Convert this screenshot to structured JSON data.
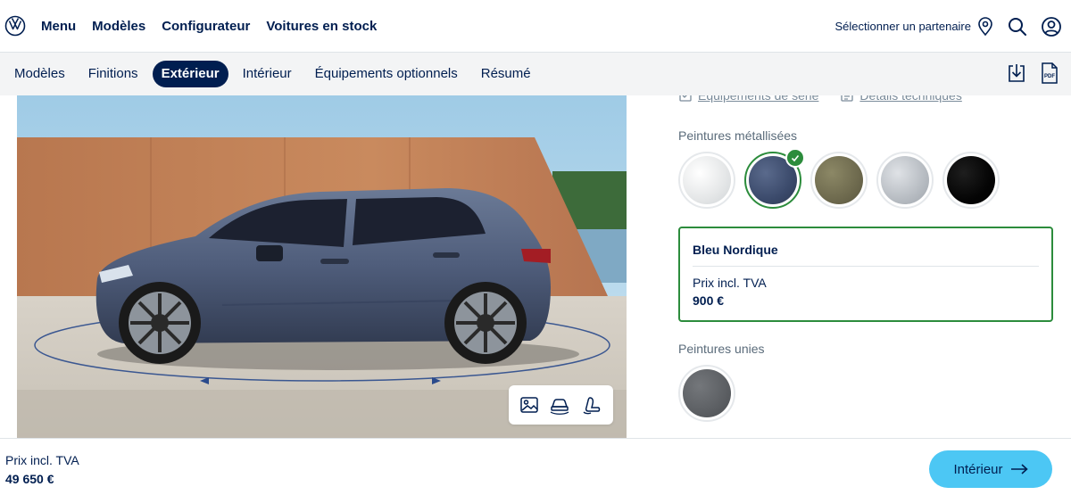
{
  "header": {
    "nav": [
      "Menu",
      "Modèles",
      "Configurateur",
      "Voitures en stock"
    ],
    "partner_label": "Sélectionner un partenaire"
  },
  "subnav": {
    "tabs": [
      "Modèles",
      "Finitions",
      "Extérieur",
      "Intérieur",
      "Équipements optionnels",
      "Résumé"
    ],
    "active_tab": "Extérieur"
  },
  "panel": {
    "links": [
      "Équipements de série",
      "Détails techniques"
    ],
    "metallic_label": "Peintures métallisées",
    "metallic_swatches": [
      {
        "color": "#e4e6e7"
      },
      {
        "color": "#3b4a6b"
      },
      {
        "color": "#6e6a4e"
      },
      {
        "color": "#b7bcc2"
      },
      {
        "color": "#050505"
      }
    ],
    "selected": {
      "name": "Bleu Nordique",
      "price_label": "Prix incl. TVA",
      "price": "900 €"
    },
    "solid_label": "Peintures unies",
    "solid_swatches": [
      {
        "color": "#5c5f63"
      }
    ]
  },
  "footer": {
    "total_label": "Prix incl. TVA",
    "total_price": "49 650 €",
    "next_label": "Intérieur"
  },
  "colors": {
    "brand": "#001e50",
    "accent": "#4cc7f4",
    "selected": "#2c8c3c"
  }
}
